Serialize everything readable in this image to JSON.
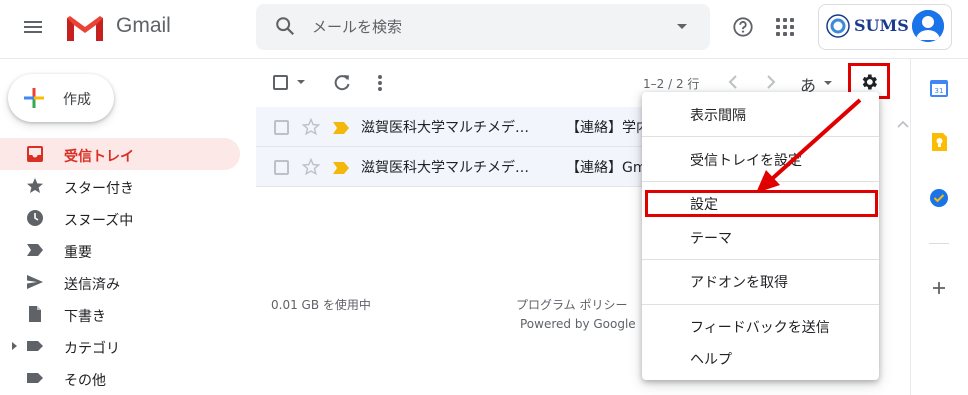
{
  "header": {
    "app_name": "Gmail",
    "search_placeholder": "メールを検索",
    "account_org": "SUMS"
  },
  "compose": {
    "label": "作成"
  },
  "sidebar": {
    "items": [
      {
        "label": "受信トレイ",
        "icon": "inbox-icon",
        "active": true
      },
      {
        "label": "スター付き",
        "icon": "star-icon"
      },
      {
        "label": "スヌーズ中",
        "icon": "clock-icon"
      },
      {
        "label": "重要",
        "icon": "important-icon"
      },
      {
        "label": "送信済み",
        "icon": "send-icon"
      },
      {
        "label": "下書き",
        "icon": "draft-icon"
      },
      {
        "label": "カテゴリ",
        "icon": "label-icon"
      },
      {
        "label": "その他",
        "icon": "label-icon"
      }
    ]
  },
  "toolbar": {
    "count": "1–2 / 2 行",
    "input_tools": "あ"
  },
  "emails": [
    {
      "sender": "滋賀医科大学マルチメデ…",
      "subject": "【連絡】学内"
    },
    {
      "sender": "滋賀医科大学マルチメデ…",
      "subject": "【連絡】Gma"
    }
  ],
  "footer": {
    "storage": "0.01 GB を使用中",
    "policy": "プログラム ポリシー",
    "powered": "Powered by Google"
  },
  "settings_menu": {
    "items": [
      "表示間隔",
      "受信トレイを設定",
      "設定",
      "テーマ",
      "アドオンを取得",
      "フィードバックを送信",
      "ヘルプ"
    ]
  },
  "colors": {
    "accent_red": "#d93025",
    "annotation_red": "#e00000",
    "active_bg": "#fce8e6",
    "brand_blue": "#1a73e8"
  }
}
